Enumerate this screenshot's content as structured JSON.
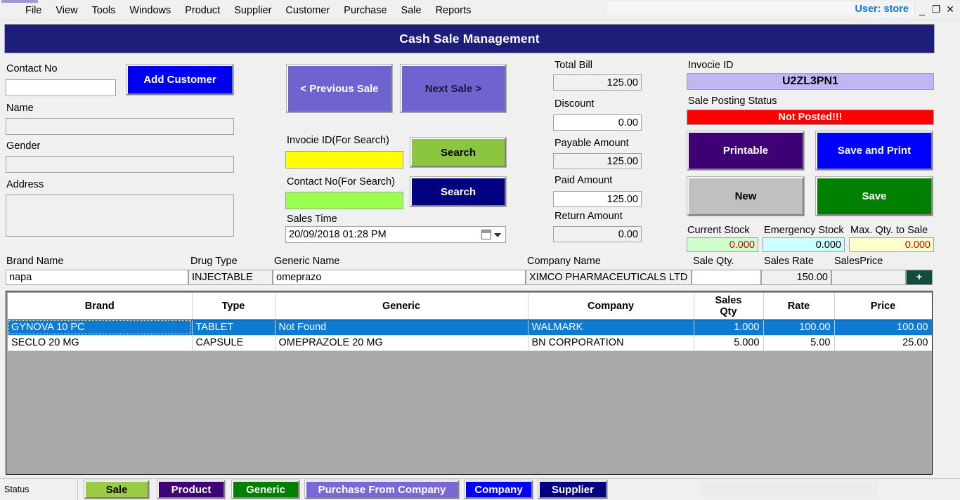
{
  "window": {
    "user_label": "User: store",
    "minimize": "_",
    "restore": "❐",
    "close": "✕"
  },
  "menubar": {
    "items": [
      "File",
      "View",
      "Tools",
      "Windows",
      "Product",
      "Supplier",
      "Customer",
      "Purchase",
      "Sale",
      "Reports"
    ]
  },
  "header": {
    "title": "Cash Sale Management"
  },
  "customer": {
    "contact_no_label": "Contact No",
    "contact_no_value": "",
    "name_label": "Name",
    "name_value": "",
    "gender_label": "Gender",
    "gender_value": "",
    "address_label": "Address",
    "address_value": "",
    "add_customer_label": "Add Customer"
  },
  "navigation": {
    "previous_sale_label": "< Previous Sale",
    "next_sale_label": "Next Sale >"
  },
  "search": {
    "invoice_id_label": "Invocie ID(For Search)",
    "invoice_id_value": "",
    "invoice_search_label": "Search",
    "contact_no_label": "Contact No(For Search)",
    "contact_no_value": "",
    "contact_search_label": "Search",
    "sales_time_label": "Sales Time",
    "sales_time_value": "20/09/2018 01:28 PM"
  },
  "billing": {
    "total_bill_label": "Total Bill",
    "total_bill_value": "125.00",
    "discount_label": "Discount",
    "discount_value": "0.00",
    "payable_amount_label": "Payable Amount",
    "payable_amount_value": "125.00",
    "paid_amount_label": "Paid Amount",
    "paid_amount_value": "125.00",
    "return_amount_label": "Return Amount",
    "return_amount_value": "0.00"
  },
  "invoice": {
    "invoice_id_label": "Invocie ID",
    "invoice_id_value": "U2ZL3PN1",
    "posting_status_label": "Sale Posting Status",
    "posting_status_value": "Not Posted!!!",
    "printable_label": "Printable",
    "save_and_print_label": "Save and Print",
    "new_label": "New",
    "save_label": "Save"
  },
  "stock": {
    "current_stock_label": "Current Stock",
    "current_stock_value": "0.000",
    "emergency_stock_label": "Emergency Stock",
    "emergency_stock_value": "0.000",
    "max_qty_label": "Max. Qty. to Sale",
    "max_qty_value": "0.000"
  },
  "entry_row": {
    "headers": {
      "brand_name": "Brand Name",
      "drug_type": "Drug Type",
      "generic_name": "Generic Name",
      "company_name": "Company Name",
      "sale_qty": "Sale Qty.",
      "sales_rate": "Sales Rate",
      "sales_price": "SalesPrice"
    },
    "values": {
      "brand_name": "napa",
      "drug_type": "INJECTABLE",
      "generic_name": "omeprazo",
      "company_name": "XIMCO PHARMACEUTICALS LTD",
      "sale_qty": "",
      "sales_rate": "150.00",
      "sales_price": ""
    },
    "add_button_label": "+"
  },
  "grid": {
    "columns": [
      "Brand",
      "Type",
      "Generic",
      "Company",
      "Sales\nQty",
      "Rate",
      "Price"
    ],
    "columns_flat": {
      "brand": "Brand",
      "type": "Type",
      "generic": "Generic",
      "company": "Company",
      "sales_qty_line1": "Sales",
      "sales_qty_line2": "Qty",
      "rate": "Rate",
      "price": "Price"
    },
    "rows": [
      {
        "brand": "GYNOVA 10 PC",
        "type": "TABLET",
        "generic": "Not Found",
        "company": "WALMARK",
        "sales_qty": "1.000",
        "rate": "100.00",
        "price": "100.00",
        "selected": true
      },
      {
        "brand": "SECLO 20 MG",
        "type": "CAPSULE",
        "generic": "OMEPRAZOLE 20 MG",
        "company": "BN CORPORATION",
        "sales_qty": "5.000",
        "rate": "5.00",
        "price": "25.00",
        "selected": false
      }
    ]
  },
  "statusbar": {
    "status_label": "Status",
    "buttons": [
      {
        "label": "Sale",
        "bg": "#99cc44",
        "fg": "#000000"
      },
      {
        "label": "Product",
        "bg": "#3f0075",
        "fg": "#ffffff"
      },
      {
        "label": "Generic",
        "bg": "#008000",
        "fg": "#ffffff"
      },
      {
        "label": "Purchase From Company",
        "bg": "#7b68d8",
        "fg": "#ffffff"
      },
      {
        "label": "Company",
        "bg": "#0000ff",
        "fg": "#ffffff"
      },
      {
        "label": "Supplier",
        "bg": "#000080",
        "fg": "#ffffff"
      }
    ]
  },
  "colors": {
    "header_blue": "#1d1d7a",
    "add_customer_blue": "#0000f0",
    "nav_purple": "#6f63cf",
    "search_green": "#8cc63f",
    "search_navy": "#000080",
    "invoice_lavender": "#bdb8f2",
    "status_red": "#ff0000",
    "printable_purple": "#3f0075",
    "save_print_blue": "#0000ff",
    "new_gray": "#c0c0c0",
    "save_green": "#008000",
    "yellow_field": "#ffff00",
    "green_field": "#9aff4d",
    "current_stock_bg": "#ccffcc",
    "emergency_stock_bg": "#ccffff",
    "max_qty_bg": "#ffffcc",
    "plus_button": "#0f4d40",
    "grid_backdrop": "#a9a9a9",
    "selection_blue": "#0d7ad4"
  }
}
